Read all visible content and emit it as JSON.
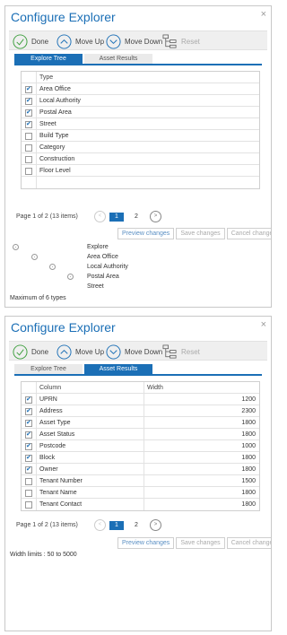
{
  "panel1": {
    "title": "Configure Explorer",
    "close": "×",
    "toolbar": {
      "done": "Done",
      "move_up": "Move Up",
      "move_down": "Move Down",
      "reset": "Reset"
    },
    "tabs": [
      "Explore Tree",
      "Asset Results"
    ],
    "active_tab": 0,
    "grid_header": "Type",
    "rows": [
      {
        "label": "Area Office",
        "checked": true
      },
      {
        "label": "Local Authority",
        "checked": true
      },
      {
        "label": "Postal Area",
        "checked": true
      },
      {
        "label": "Street",
        "checked": true
      },
      {
        "label": "Build Type",
        "checked": false
      },
      {
        "label": "Category",
        "checked": false
      },
      {
        "label": "Construction",
        "checked": false
      },
      {
        "label": "Floor Level",
        "checked": false
      }
    ],
    "pager": {
      "info": "Page 1 of 2 (13 items)",
      "page1": "1",
      "page2": "2",
      "prev": "<",
      "next": ">"
    },
    "actions": {
      "preview": "Preview changes",
      "save": "Save changes",
      "cancel": "Cancel changes"
    },
    "tree": [
      "Explore",
      "Area Office",
      "Local Authority",
      "Postal Area",
      "Street"
    ],
    "note": "Maximum of 6 types"
  },
  "panel2": {
    "title": "Configure Explorer",
    "close": "×",
    "toolbar": {
      "done": "Done",
      "move_up": "Move Up",
      "move_down": "Move Down",
      "reset": "Reset"
    },
    "tabs": [
      "Explore Tree",
      "Asset Results"
    ],
    "active_tab": 1,
    "grid_header": {
      "column": "Column",
      "width": "Width"
    },
    "rows": [
      {
        "label": "UPRN",
        "width": "1200",
        "checked": true
      },
      {
        "label": "Address",
        "width": "2300",
        "checked": true
      },
      {
        "label": "Asset Type",
        "width": "1800",
        "checked": true
      },
      {
        "label": "Asset Status",
        "width": "1800",
        "checked": true
      },
      {
        "label": "Postcode",
        "width": "1000",
        "checked": true
      },
      {
        "label": "Block",
        "width": "1800",
        "checked": true
      },
      {
        "label": "Owner",
        "width": "1800",
        "checked": true
      },
      {
        "label": "Tenant Number",
        "width": "1500",
        "checked": false
      },
      {
        "label": "Tenant Name",
        "width": "1800",
        "checked": false
      },
      {
        "label": "Tenant Contact",
        "width": "1800",
        "checked": false
      }
    ],
    "pager": {
      "info": "Page 1 of 2 (13 items)",
      "page1": "1",
      "page2": "2",
      "prev": "<",
      "next": ">"
    },
    "actions": {
      "preview": "Preview changes",
      "save": "Save changes",
      "cancel": "Cancel changes"
    },
    "note": "Width limits : 50 to 5000"
  },
  "colors": {
    "accent": "#1b6fb6",
    "toolbar_bg": "#efefef",
    "check": "#1b6fb6"
  },
  "icons": {
    "done": "check-circle-icon",
    "move_up": "chevron-up-circle-icon",
    "move_down": "chevron-down-circle-icon",
    "reset": "tree-reset-icon"
  }
}
